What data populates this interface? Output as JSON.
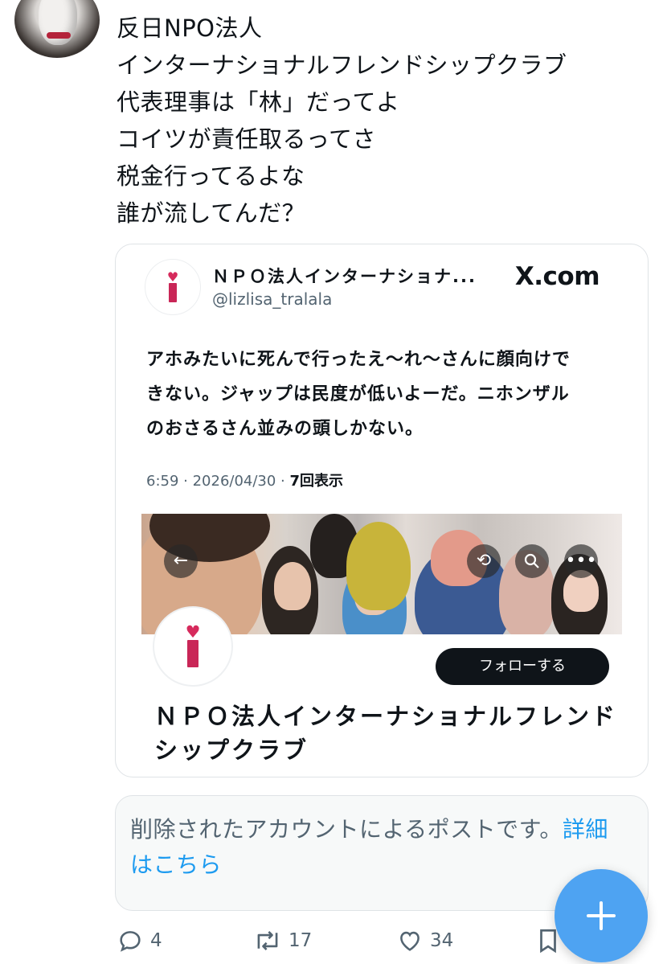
{
  "tweet": {
    "lines": [
      "反日NPO法人",
      "インターナショナルフレンドシップクラブ",
      "代表理事は「林」だってよ",
      "コイツが責任取るってさ",
      "税金行ってるよな",
      "誰が流してんだ？"
    ]
  },
  "quote": {
    "name": "ＮＰＯ法人インターナショナ...",
    "handle": "@lizlisa_tralala",
    "source": "X.com",
    "body_lines": [
      "アホみたいに死んで行ったえ〜れ〜さんに顔向けで",
      "きない。ジャップは民度が低いよーだ。ニホンザル",
      "のおさるさん並みの頭しかない。"
    ],
    "meta_time": "6:59 · 2026/04/30 · ",
    "meta_views": "7回表示",
    "profile": {
      "follow_label": "フォローする",
      "name_lines": [
        "ＮＰＯ法人インターナショナルフレンド",
        "シップクラブ"
      ]
    }
  },
  "deleted": {
    "text": "削除されたアカウントによるポストです。",
    "link": "詳細はこちら"
  },
  "actions": {
    "replies": "4",
    "reposts": "17",
    "likes": "34"
  },
  "icons": [
    "avatar",
    "back-arrow-icon",
    "repost-icon",
    "search-icon",
    "more-icon",
    "reply-icon",
    "like-icon",
    "bookmark-icon",
    "plus-icon"
  ],
  "colors": {
    "accent": "#1d9bf0",
    "fab": "#4ea3f2",
    "brand_pink": "#c92657"
  }
}
